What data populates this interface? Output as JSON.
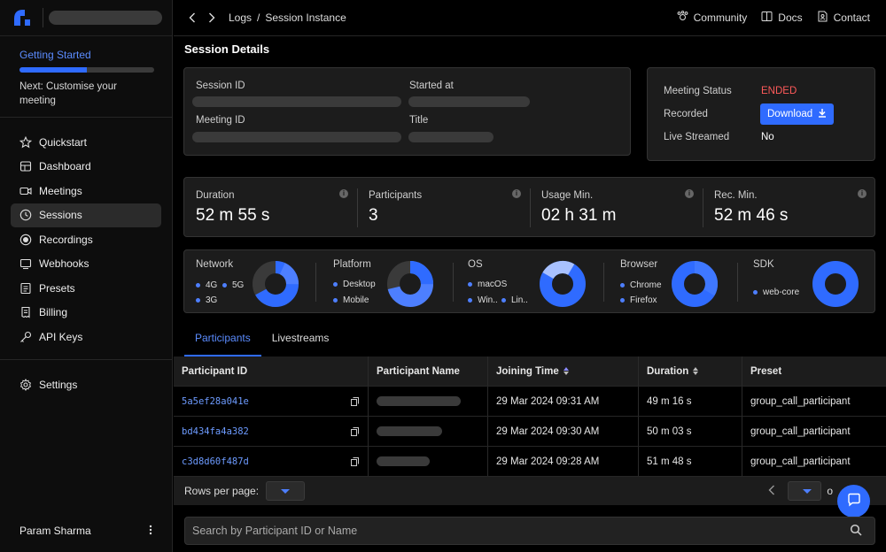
{
  "sidebar": {
    "getting_started": {
      "title": "Getting Started",
      "progress": 0.5,
      "next": "Next: Customise your meeting"
    },
    "items": [
      {
        "label": "Quickstart",
        "icon": "star-icon"
      },
      {
        "label": "Dashboard",
        "icon": "dashboard-icon"
      },
      {
        "label": "Meetings",
        "icon": "video-icon"
      },
      {
        "label": "Sessions",
        "icon": "clock-icon",
        "active": true
      },
      {
        "label": "Recordings",
        "icon": "record-icon"
      },
      {
        "label": "Webhooks",
        "icon": "webhook-icon"
      },
      {
        "label": "Presets",
        "icon": "presets-icon"
      },
      {
        "label": "Billing",
        "icon": "billing-icon"
      },
      {
        "label": "API Keys",
        "icon": "key-icon"
      }
    ],
    "settings": "Settings",
    "user": "Param Sharma"
  },
  "topbar": {
    "crumbs": [
      "Logs",
      "/",
      "Session Instance"
    ],
    "links": [
      "Community",
      "Docs",
      "Contact"
    ]
  },
  "page": {
    "title": "Session Details",
    "details": {
      "session_id_label": "Session ID",
      "started_at_label": "Started at",
      "meeting_id_label": "Meeting ID",
      "title_label": "Title"
    },
    "status": {
      "meeting_status_label": "Meeting Status",
      "meeting_status_value": "ENDED",
      "recorded_label": "Recorded",
      "download_label": "Download",
      "live_streamed_label": "Live Streamed",
      "live_streamed_value": "No"
    },
    "stats": [
      {
        "label": "Duration",
        "value": "52 m 55 s"
      },
      {
        "label": "Participants",
        "value": "3"
      },
      {
        "label": "Usage Min.",
        "value": "02 h 31 m"
      },
      {
        "label": "Rec. Min.",
        "value": "52 m 46 s"
      }
    ],
    "breakdown": [
      {
        "title": "Network",
        "legend": [
          "4G",
          "5G",
          "3G"
        ]
      },
      {
        "title": "Platform",
        "legend": [
          "Desktop",
          "Mobile"
        ]
      },
      {
        "title": "OS",
        "legend": [
          "macOS",
          "Win..",
          "Lin.."
        ]
      },
      {
        "title": "Browser",
        "legend": [
          "Chrome",
          "Firefox"
        ]
      },
      {
        "title": "SDK",
        "legend": [
          "web-core"
        ]
      }
    ],
    "tabs": [
      "Participants",
      "Livestreams"
    ],
    "table": {
      "headers": [
        "Participant ID",
        "Participant Name",
        "Joining Time",
        "Duration",
        "Preset"
      ],
      "rows": [
        {
          "id": "5a5ef28a041e",
          "joined": "29 Mar 2024 09:31 AM",
          "duration": "49 m 16 s",
          "preset": "group_call_participant"
        },
        {
          "id": "bd434fa4a382",
          "joined": "29 Mar 2024 09:30 AM",
          "duration": "50 m 03 s",
          "preset": "group_call_participant"
        },
        {
          "id": "c3d8d60f487d",
          "joined": "29 Mar 2024 09:28 AM",
          "duration": "51 m 48 s",
          "preset": "group_call_participant"
        }
      ]
    },
    "pager": {
      "rows_label": "Rows per page:",
      "of_label": "o"
    },
    "search_placeholder": "Search by Participant ID or Name"
  },
  "colors": {
    "accent": "#2f6bff",
    "ended": "#ff5a5a",
    "link": "#6d9bff"
  }
}
